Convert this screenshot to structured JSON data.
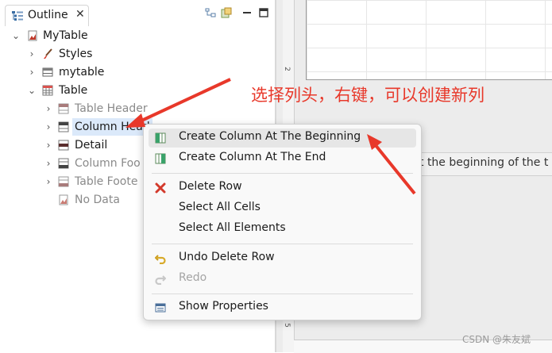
{
  "outline": {
    "tab_label": "Outline",
    "tab_close": "✕",
    "tree": [
      {
        "label": "MyTable",
        "twisty": "⌄",
        "icon": "report-icon"
      },
      {
        "label": "Styles",
        "twisty": "›",
        "icon": "brush-icon"
      },
      {
        "label": "mytable",
        "twisty": "›",
        "icon": "dataset-icon"
      },
      {
        "label": "Table",
        "twisty": "⌄",
        "icon": "table-icon"
      },
      {
        "label": "Table Header",
        "twisty": "›",
        "icon": "table-band-icon"
      },
      {
        "label": "Column Head",
        "twisty": "›",
        "icon": "table-band-icon"
      },
      {
        "label": "Detail",
        "twisty": "›",
        "icon": "table-band-icon"
      },
      {
        "label": "Column Foo",
        "twisty": "›",
        "icon": "table-band-icon"
      },
      {
        "label": "Table Foote",
        "twisty": "›",
        "icon": "table-band-icon"
      },
      {
        "label": "No Data",
        "twisty": "",
        "icon": "report-icon"
      }
    ]
  },
  "annotation": {
    "text": "选择列头，右键，可以创建新列",
    "color": "#e8382a"
  },
  "designer": {
    "tooltip_text": "t the beginning of the t",
    "ruler_numbers": [
      "2",
      "5"
    ]
  },
  "context_menu": {
    "items": [
      {
        "label": "Create Column At The Beginning",
        "icon": "column-insert-left-icon",
        "enabled": true,
        "hovered": true
      },
      {
        "label": "Create Column At The End",
        "icon": "column-insert-right-icon",
        "enabled": true
      },
      {
        "label": "Delete Row",
        "icon": "delete-x-icon",
        "enabled": true
      },
      {
        "label": "Select All Cells",
        "icon": "",
        "enabled": true
      },
      {
        "label": "Select All Elements",
        "icon": "",
        "enabled": true
      },
      {
        "label": "Undo Delete Row",
        "icon": "undo-icon",
        "enabled": true
      },
      {
        "label": "Redo",
        "icon": "redo-icon",
        "enabled": false
      },
      {
        "label": "Show Properties",
        "icon": "properties-icon",
        "enabled": true
      }
    ]
  },
  "watermark": "CSDN @朱友斌"
}
